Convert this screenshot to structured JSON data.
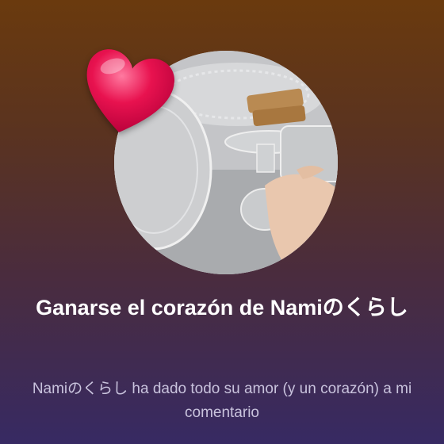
{
  "notification": {
    "title": "Ganarse el corazón de Namiのくらし",
    "message": "Namiのくらし ha dado todo su amor (y un corazón) a mi comentario"
  },
  "icons": {
    "heart": "heart-icon",
    "avatar": "channel-avatar"
  },
  "colors": {
    "heart": "#e8124f",
    "title": "#ffffff",
    "message": "#c9c3dd"
  }
}
